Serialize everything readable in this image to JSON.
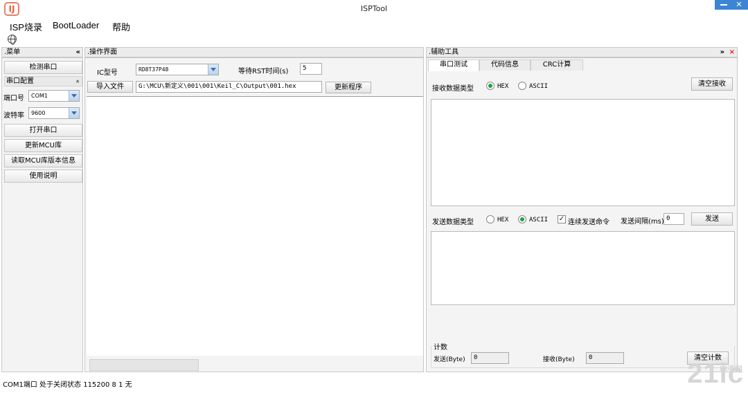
{
  "window": {
    "title": "ISPTool",
    "logo_text": "IJ"
  },
  "menubar": {
    "items": [
      "ISP烧录",
      "BootLoader",
      "帮助"
    ]
  },
  "left_panel": {
    "title": ".菜单",
    "collapse_glyph": "«",
    "detect_button": "检测串口",
    "serial_section": {
      "title": "串口配置",
      "collapse_glyph": "«"
    },
    "port_label": "端口号",
    "port_value": "COM1",
    "baud_label": "波特率",
    "baud_value": "9600",
    "buttons": [
      "打开串口",
      "更新MCU库",
      "读取MCU库版本信息",
      "使用说明"
    ]
  },
  "center_panel": {
    "title": ".操作界面",
    "ic_label": "IC型号",
    "ic_value": "RD8T37P48",
    "rst_label": "等待RST时间(s)",
    "rst_value": "5",
    "import_button": "导入文件",
    "file_path": "G:\\MCU\\新定义\\001\\001\\Keil_C\\Output\\001.hex",
    "update_button": "更新程序"
  },
  "right_panel": {
    "title": ".辅助工具",
    "header_icons": {
      "expand": "»",
      "close": "×"
    },
    "tabs": [
      "串口测试",
      "代码信息",
      "CRC计算"
    ],
    "receive_type_label": "接收数据类型",
    "receive_hex": "HEX",
    "receive_ascii": "ASCII",
    "clear_receive_button": "清空接收",
    "send_type_label": "发送数据类型",
    "send_hex": "HEX",
    "send_ascii": "ASCII",
    "continuous_send_label": "连续发送命令",
    "send_interval_label": "发送间隔(ms)",
    "send_interval_value": "0",
    "send_button": "发送",
    "count_section_title": "计数",
    "sent_label": "发送(Byte)",
    "sent_value": "0",
    "recv_label": "接收(Byte)",
    "recv_value": "0",
    "clear_count_button": "清空计数"
  },
  "statusbar": {
    "text": "COM1端口 处于关闭状态 115200 8 1 无"
  },
  "watermark": {
    "text": "21ic",
    "sub": "电子网"
  }
}
